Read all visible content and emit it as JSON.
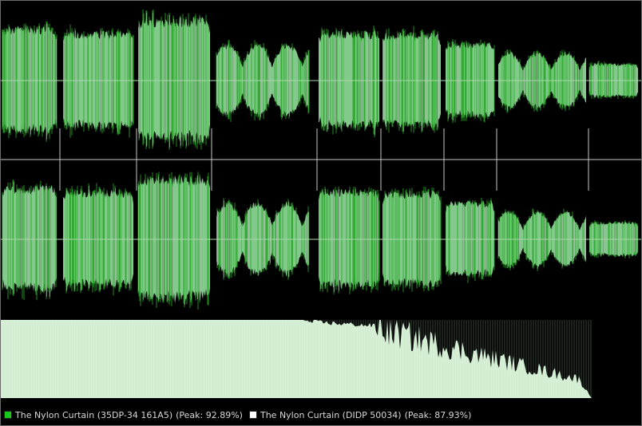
{
  "colors": {
    "background": "#000000",
    "waveform_fill": "#84c98c",
    "waveform_edge": "#28a428",
    "waveform_alt_edge": "#bfbfbf",
    "centerline": "#a8d8a8",
    "separator": "#c8c8c8",
    "spectrum_fill": "#d8f0d8",
    "legend_text": "#d8d8d8"
  },
  "legend": {
    "items": [
      {
        "color": "#18c818",
        "label": "The Nylon Curtain (35DP-34 161A5)",
        "peak": "(Peak: 92.89%)"
      },
      {
        "color": "#ffffff",
        "label": "The Nylon Curtain (DIDP 50034)",
        "peak": "(Peak: 87.93%)"
      }
    ]
  },
  "tracks": [
    {
      "amp": 0.78,
      "env": "flat"
    },
    {
      "amp": 0.72,
      "env": "flat"
    },
    {
      "amp": 0.92,
      "env": "flat"
    },
    {
      "amp": 0.55,
      "env": "wavy"
    },
    {
      "amp": 0.72,
      "env": "flat"
    },
    {
      "amp": 0.7,
      "env": "flat"
    },
    {
      "amp": 0.55,
      "env": "flat"
    },
    {
      "amp": 0.42,
      "env": "wavy"
    },
    {
      "amp": 0.25,
      "env": "flat"
    }
  ]
}
